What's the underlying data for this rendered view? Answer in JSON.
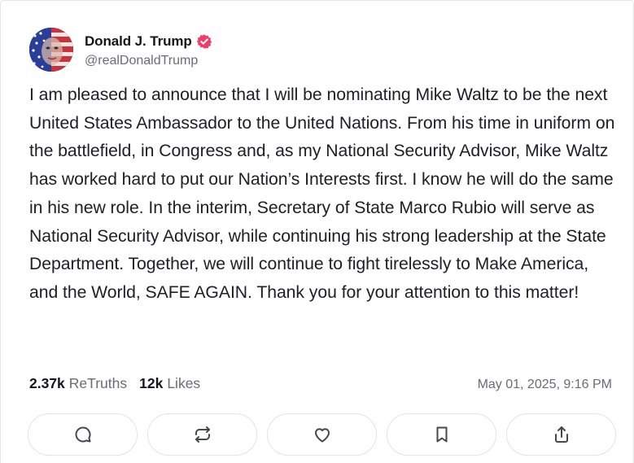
{
  "author": {
    "display_name": "Donald J. Trump",
    "handle": "@realDonaldTrump",
    "verified": true,
    "verified_color": "#ee3f6b"
  },
  "post": {
    "text": "I am pleased to announce that I will be nominating Mike Waltz to be the next United States Ambassador to the United Nations. From his time in uniform on the battlefield, in Congress and, as my National Security Advisor, Mike Waltz has worked hard to put our Nation’s Interests first. I know he will do the same in his new role. In the interim, Secretary of State Marco Rubio will serve as National Security Advisor, while continuing his strong leadership at the State Department. Together, we will continue to fight tirelessly to Make America, and the World, SAFE AGAIN. Thank you for your attention to this matter!",
    "retruths_count": "2.37k",
    "retruths_label": "ReTruths",
    "likes_count": "12k",
    "likes_label": "Likes",
    "timestamp": "May 01, 2025, 9:16 PM"
  },
  "actions": [
    {
      "name": "reply",
      "icon": "comment-icon"
    },
    {
      "name": "retruth",
      "icon": "repost-icon"
    },
    {
      "name": "like",
      "icon": "heart-icon"
    },
    {
      "name": "bookmark",
      "icon": "bookmark-icon"
    },
    {
      "name": "share",
      "icon": "share-icon"
    }
  ]
}
